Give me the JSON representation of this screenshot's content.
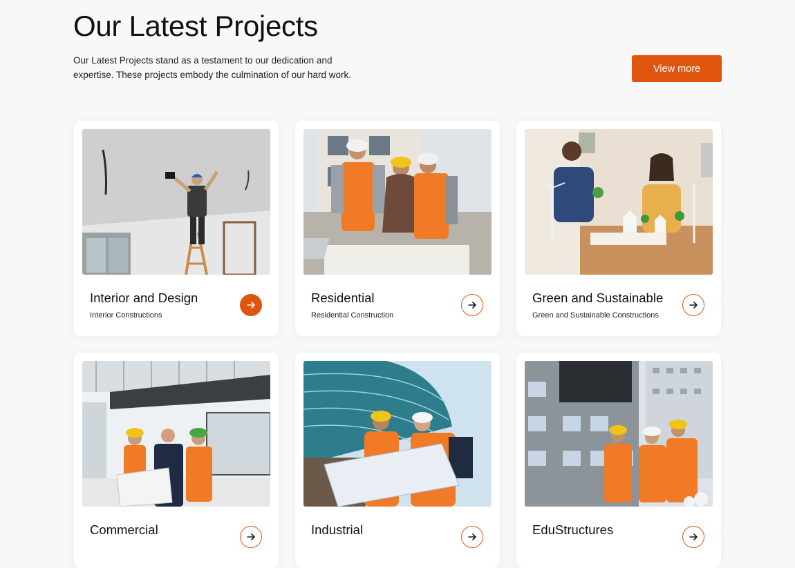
{
  "header": {
    "title": "Our Latest Projects",
    "intro_line1": "Our Latest Projects stand as a testament to our dedication and",
    "intro_line2": "expertise. These projects embody the culmination of our hard work.",
    "view_more_label": "View more"
  },
  "colors": {
    "accent": "#e0550e",
    "background": "#f8f8f8",
    "card": "#ffffff"
  },
  "projects": [
    {
      "title": "Interior and Design",
      "subtitle": "Interior Constructions",
      "image": "worker-on-ladder-ceiling-photo",
      "arrow_active": true
    },
    {
      "title": "Residential",
      "subtitle": "Residential Construction",
      "image": "engineers-reviewing-plans-photo",
      "arrow_active": false
    },
    {
      "title": "Green and Sustainable",
      "subtitle": "Green and Sustainable Constructions",
      "image": "eco-architecture-model-photo",
      "arrow_active": false
    },
    {
      "title": "Commercial",
      "subtitle": "",
      "image": "team-in-glass-atrium-photo",
      "arrow_active": false
    },
    {
      "title": "Industrial",
      "subtitle": "",
      "image": "engineers-with-blueprint-photo",
      "arrow_active": false
    },
    {
      "title": "EduStructures",
      "subtitle": "",
      "image": "workers-at-building-site-photo",
      "arrow_active": false
    }
  ]
}
